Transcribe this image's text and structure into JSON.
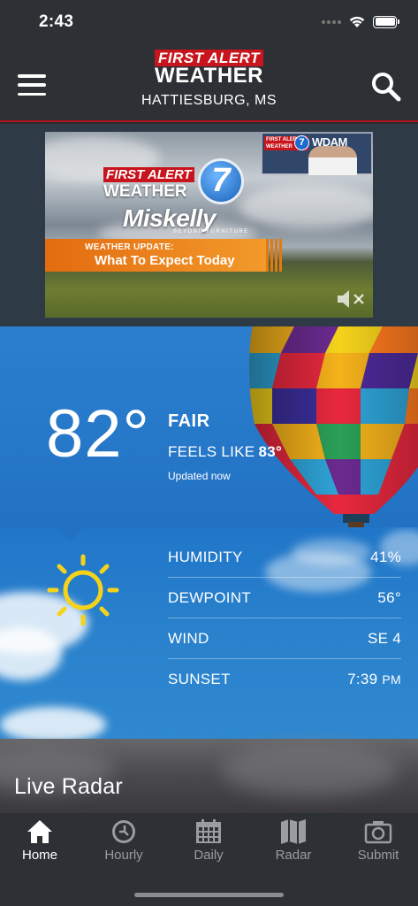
{
  "status_bar": {
    "time": "2:43"
  },
  "header": {
    "logo_top": "FIRST ALERT",
    "logo_bottom": "WEATHER",
    "location": "HATTIESBURG, MS",
    "menu_icon": "hamburger-menu-icon",
    "search_icon": "search-icon",
    "accent_color": "#b3121c"
  },
  "video_ad": {
    "logo_top": "FIRST ALERT",
    "logo_bottom": "WEATHER",
    "channel_number": "7",
    "sponsor": "Miskelly",
    "sponsor_sub": "BEYOND FURNITURE",
    "banner_line1": "WEATHER UPDATE:",
    "banner_line2": "What To Expect Today",
    "pip_logo": "FIRST ALERT WEATHER",
    "pip_channel": "7",
    "pip_station": "WDAM",
    "mute_icon": "speaker-muted-icon"
  },
  "current": {
    "temperature": "82°",
    "condition": "FAIR",
    "feels_like_label": "FEELS LIKE",
    "feels_like_value": "83°",
    "updated": "Updated now",
    "condition_icon": "sun-icon"
  },
  "details": [
    {
      "label": "HUMIDITY",
      "value": "41%",
      "unit": ""
    },
    {
      "label": "DEWPOINT",
      "value": "56°",
      "unit": ""
    },
    {
      "label": "WIND",
      "value": "SE 4",
      "unit": ""
    },
    {
      "label": "SUNSET",
      "value": "7:39",
      "unit": "PM"
    }
  ],
  "radar": {
    "title": "Live Radar"
  },
  "tabs": [
    {
      "label": "Home",
      "icon": "home-icon",
      "active": true
    },
    {
      "label": "Hourly",
      "icon": "clock-icon",
      "active": false
    },
    {
      "label": "Daily",
      "icon": "calendar-icon",
      "active": false
    },
    {
      "label": "Radar",
      "icon": "map-icon",
      "active": false
    },
    {
      "label": "Submit",
      "icon": "camera-icon",
      "active": false
    }
  ]
}
